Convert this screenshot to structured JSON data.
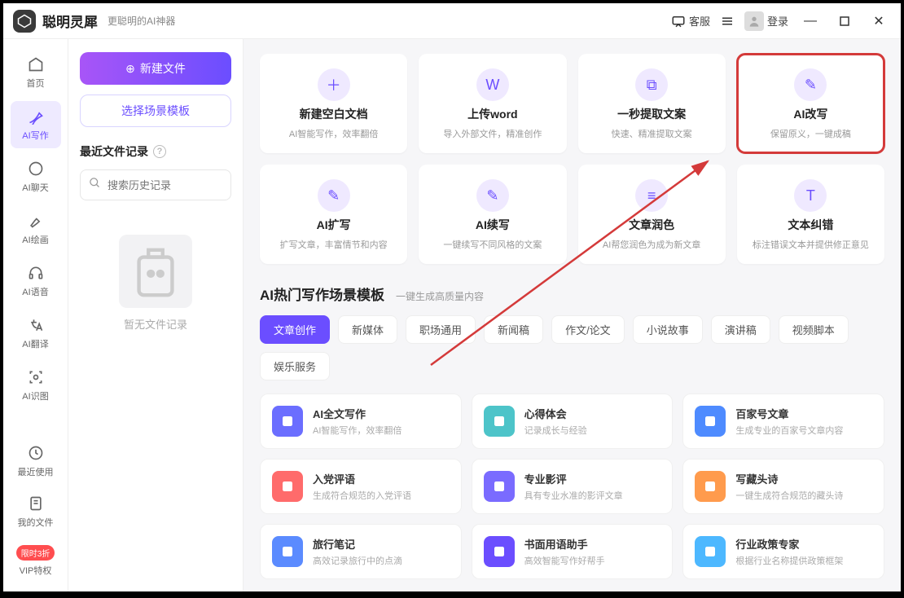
{
  "app": {
    "title": "聪明灵犀",
    "subtitle": "更聪明的AI神器"
  },
  "titlebar": {
    "support": "客服",
    "login": "登录"
  },
  "sidebar": {
    "items": [
      {
        "label": "首页"
      },
      {
        "label": "AI写作"
      },
      {
        "label": "AI聊天"
      },
      {
        "label": "AI绘画"
      },
      {
        "label": "AI语音"
      },
      {
        "label": "AI翻译"
      },
      {
        "label": "AI识图"
      }
    ],
    "bottom": [
      {
        "label": "最近使用"
      },
      {
        "label": "我的文件"
      },
      {
        "label": "VIP特权",
        "badge": "限时3折"
      }
    ]
  },
  "panel": {
    "newBtn": "新建文件",
    "templateBtn": "选择场景模板",
    "recentTitle": "最近文件记录",
    "searchPlaceholder": "搜索历史记录",
    "emptyText": "暂无文件记录"
  },
  "cards": [
    {
      "title": "新建空白文档",
      "desc": "AI智能写作，效率翻倍"
    },
    {
      "title": "上传word",
      "desc": "导入外部文件，精准创作"
    },
    {
      "title": "一秒提取文案",
      "desc": "快速、精准提取文案"
    },
    {
      "title": "AI改写",
      "desc": "保留原义，一键成稿",
      "highlighted": true
    },
    {
      "title": "AI扩写",
      "desc": "扩写文章，丰富情节和内容"
    },
    {
      "title": "AI续写",
      "desc": "一键续写不同风格的文案"
    },
    {
      "title": "文章润色",
      "desc": "AI帮您润色为成为新文章"
    },
    {
      "title": "文本纠错",
      "desc": "标注错误文本并提供修正意见"
    }
  ],
  "section": {
    "title": "AI热门写作场景模板",
    "sub": "一键生成高质量内容"
  },
  "tabs": [
    "文章创作",
    "新媒体",
    "职场通用",
    "新闻稿",
    "作文/论文",
    "小说故事",
    "演讲稿",
    "视频脚本",
    "娱乐服务"
  ],
  "templates": [
    {
      "title": "AI全文写作",
      "desc": "AI智能写作，效率翻倍",
      "color": "#6b6eff"
    },
    {
      "title": "心得体会",
      "desc": "记录成长与经验",
      "color": "#4dc4c9"
    },
    {
      "title": "百家号文章",
      "desc": "生成专业的百家号文章内容",
      "color": "#4e8bff"
    },
    {
      "title": "入党评语",
      "desc": "生成符合规范的入党评语",
      "color": "#ff6b6b"
    },
    {
      "title": "专业影评",
      "desc": "具有专业水准的影评文章",
      "color": "#7a6bff"
    },
    {
      "title": "写藏头诗",
      "desc": "一键生成符合规范的藏头诗",
      "color": "#ff9b4d"
    },
    {
      "title": "旅行笔记",
      "desc": "高效记录旅行中的点滴",
      "color": "#5b8bff"
    },
    {
      "title": "书面用语助手",
      "desc": "高效智能写作好帮手",
      "color": "#6b4eff"
    },
    {
      "title": "行业政策专家",
      "desc": "根据行业名称提供政策框架",
      "color": "#4db8ff"
    }
  ]
}
